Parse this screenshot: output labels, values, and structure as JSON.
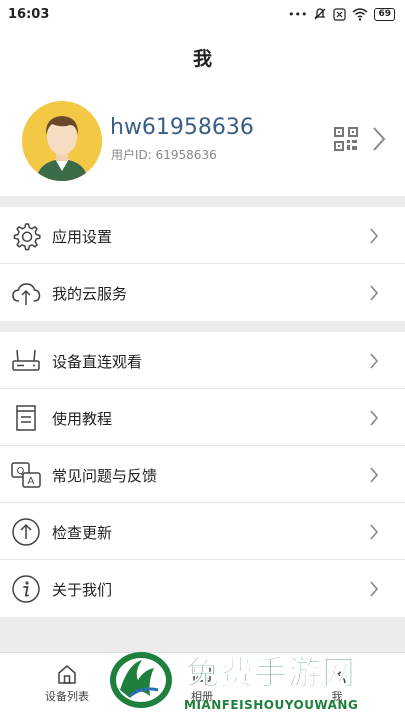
{
  "status_bar": {
    "time": "16:03",
    "battery": "69"
  },
  "header": {
    "title": "我"
  },
  "profile": {
    "username": "hw61958636",
    "user_id": "用户ID: 61958636"
  },
  "menu_groups": [
    [
      {
        "label": "应用设置",
        "icon": "gear-icon"
      },
      {
        "label": "我的云服务",
        "icon": "cloud-upload-icon"
      }
    ],
    [
      {
        "label": "设备直连观看",
        "icon": "router-icon"
      },
      {
        "label": "使用教程",
        "icon": "document-icon"
      },
      {
        "label": "常见问题与反馈",
        "icon": "faq-chat-icon"
      },
      {
        "label": "检查更新",
        "icon": "arrow-up-circle-icon"
      },
      {
        "label": "关于我们",
        "icon": "info-icon"
      }
    ]
  ],
  "tabbar": {
    "tabs": [
      {
        "label": "设备列表",
        "icon": "home-icon"
      },
      {
        "label": "相册",
        "icon": "album-icon"
      },
      {
        "label": "我",
        "icon": "person-icon"
      }
    ]
  },
  "watermark": {
    "title": "免费手游网",
    "subtitle": "MIANFEISHOUYOUWANG"
  },
  "colors": {
    "accent": "#3a5f86",
    "watermark": "#1f7f3d",
    "avatar_bg": "#f3c844"
  }
}
